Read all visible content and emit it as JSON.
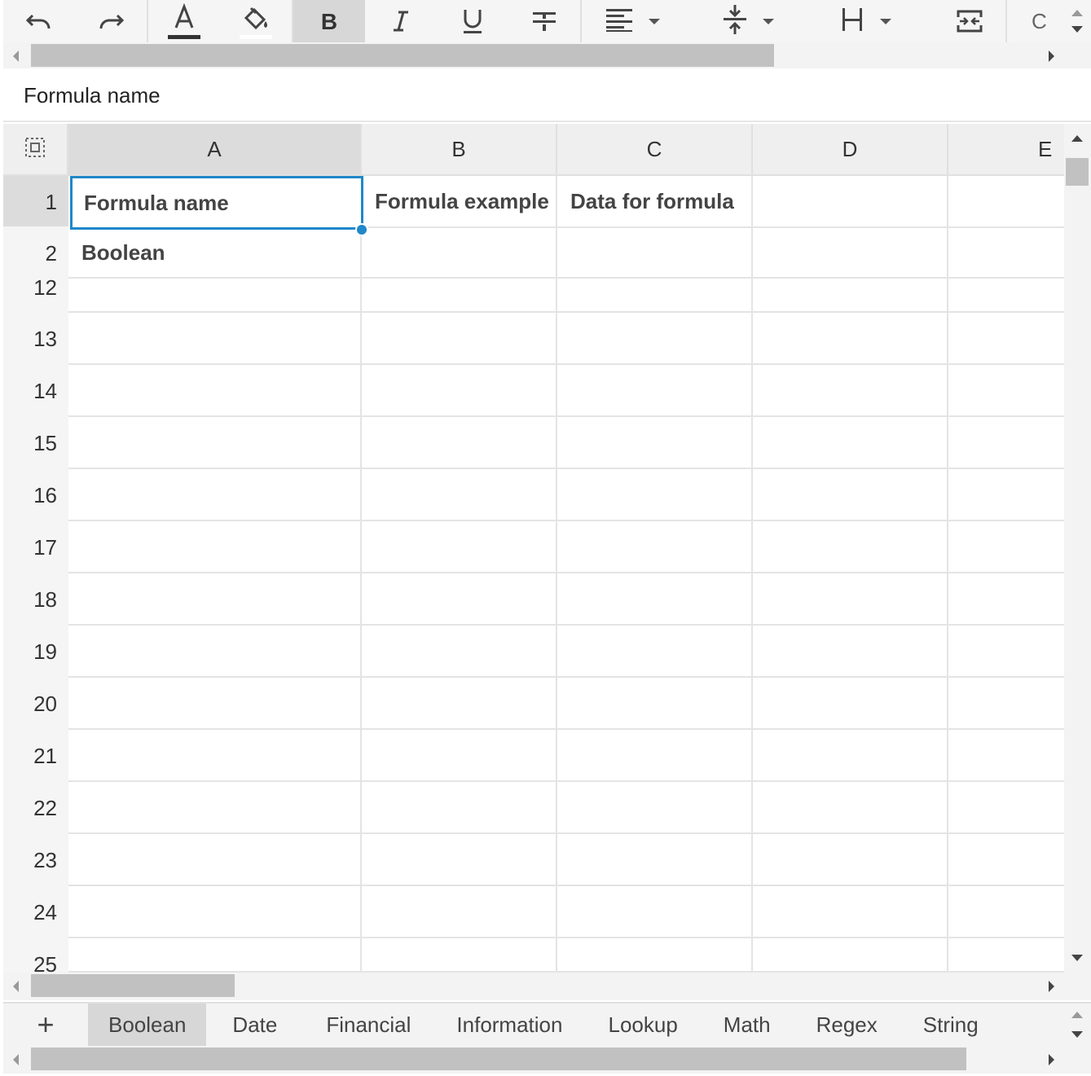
{
  "toolbar": {
    "buttons": [
      "undo-icon",
      "redo-icon",
      "font-color-icon",
      "fill-color-icon",
      "bold-icon",
      "italic-icon",
      "underline-icon",
      "strikethrough-icon",
      "align-left-icon",
      "vertical-align-icon",
      "text-wrap-icon",
      "merge-cells-icon"
    ],
    "overflow_label": "C",
    "active_button": "bold",
    "accent_color": "#1e88c9"
  },
  "formula_bar": {
    "value": "Formula name"
  },
  "grid": {
    "columns": [
      "A",
      "B",
      "C",
      "D",
      "E"
    ],
    "selected_column": "A",
    "rows": [
      "1",
      "2",
      "12",
      "13",
      "14",
      "15",
      "16",
      "17",
      "18",
      "19",
      "20",
      "21",
      "22",
      "23",
      "24",
      "25"
    ],
    "selected_row": "1",
    "cells": {
      "A1": "Formula name",
      "B1": "Formula example",
      "C1": "Data for formula",
      "A2": "Boolean"
    }
  },
  "sheet_tabs": {
    "add_label": "+",
    "tabs": [
      "Boolean",
      "Date",
      "Financial",
      "Information",
      "Lookup",
      "Math",
      "Regex",
      "String"
    ],
    "active_tab": "Boolean"
  }
}
